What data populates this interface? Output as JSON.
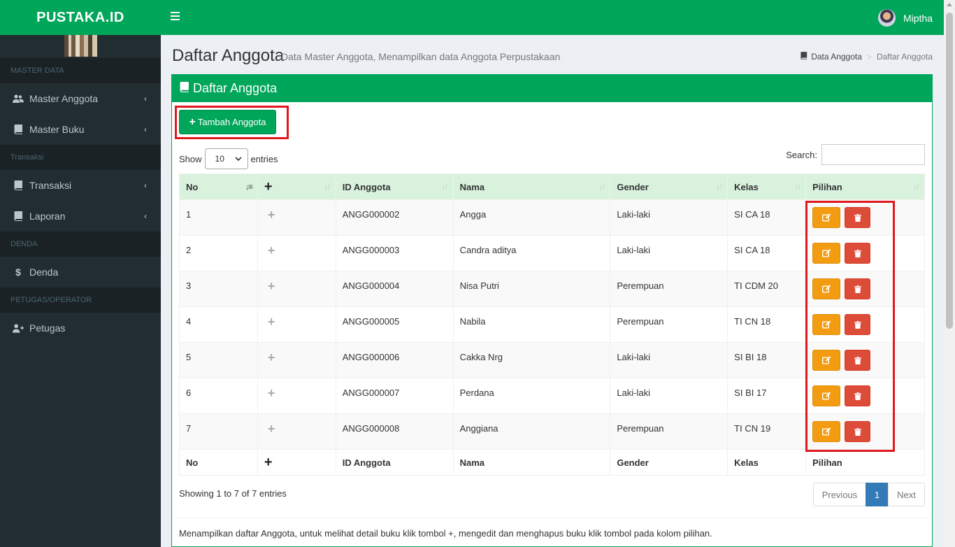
{
  "app": {
    "logo": "PUSTAKA.ID",
    "user_name": "Miptha"
  },
  "sidebar": {
    "sections": [
      {
        "header": "MASTER DATA",
        "items": [
          {
            "label": "Master Anggota",
            "icon": "users-icon",
            "chevron": "‹"
          },
          {
            "label": "Master Buku",
            "icon": "book-icon",
            "chevron": "‹"
          }
        ]
      },
      {
        "header": "Transaksi",
        "items": [
          {
            "label": "Transaksi",
            "icon": "book-icon",
            "chevron": "‹"
          },
          {
            "label": "Laporan",
            "icon": "book-icon",
            "chevron": "‹"
          }
        ]
      },
      {
        "header": "DENDA",
        "items": [
          {
            "label": "Denda",
            "icon": "dollar-icon"
          }
        ]
      },
      {
        "header": "PETUGAS/OPERATOR",
        "items": [
          {
            "label": "Petugas",
            "icon": "user-plus-icon"
          }
        ]
      }
    ]
  },
  "header": {
    "title": "Daftar Anggota",
    "subtitle": "Data Master Anggota, Menampilkan data Anggota Perpustakaan",
    "breadcrumb": [
      "Data Anggota",
      "Daftar Anggota"
    ]
  },
  "box": {
    "title": "Daftar Anggota",
    "add_button": "Tambah Anggota",
    "show_label": "Show",
    "entries_value": "10",
    "entries_label": "entries",
    "search_label": "Search:",
    "search_value": ""
  },
  "table": {
    "columns": [
      "No",
      "+",
      "ID Anggota",
      "Nama",
      "Gender",
      "Kelas",
      "Pilihan"
    ],
    "rows": [
      {
        "no": "1",
        "id": "ANGG000002",
        "nama": "Angga",
        "gender": "Laki-laki",
        "kelas": "SI CA 18"
      },
      {
        "no": "2",
        "id": "ANGG000003",
        "nama": "Candra aditya",
        "gender": "Laki-laki",
        "kelas": "SI CA 18"
      },
      {
        "no": "3",
        "id": "ANGG000004",
        "nama": "Nisa Putri",
        "gender": "Perempuan",
        "kelas": "TI CDM 20"
      },
      {
        "no": "4",
        "id": "ANGG000005",
        "nama": "Nabila",
        "gender": "Perempuan",
        "kelas": "TI CN 18"
      },
      {
        "no": "5",
        "id": "ANGG000006",
        "nama": "Cakka Nrg",
        "gender": "Laki-laki",
        "kelas": "SI BI 18"
      },
      {
        "no": "6",
        "id": "ANGG000007",
        "nama": "Perdana",
        "gender": "Laki-laki",
        "kelas": "SI BI 17"
      },
      {
        "no": "7",
        "id": "ANGG000008",
        "nama": "Anggiana",
        "gender": "Perempuan",
        "kelas": "TI CN 19"
      }
    ]
  },
  "footer": {
    "info": "Showing 1 to 7 of 7 entries",
    "prev": "Previous",
    "page": "1",
    "next": "Next",
    "note": "Menampilkan daftar Anggota, untuk melihat detail buku klik tombol +, mengedit dan menghapus buku klik tombol pada kolom pilihan."
  },
  "colors": {
    "primary": "#00a65a",
    "sidebar": "#222d32",
    "edit": "#f39c12",
    "delete": "#dd4b39",
    "highlight": "#e0181f",
    "page_active": "#337ab7"
  }
}
